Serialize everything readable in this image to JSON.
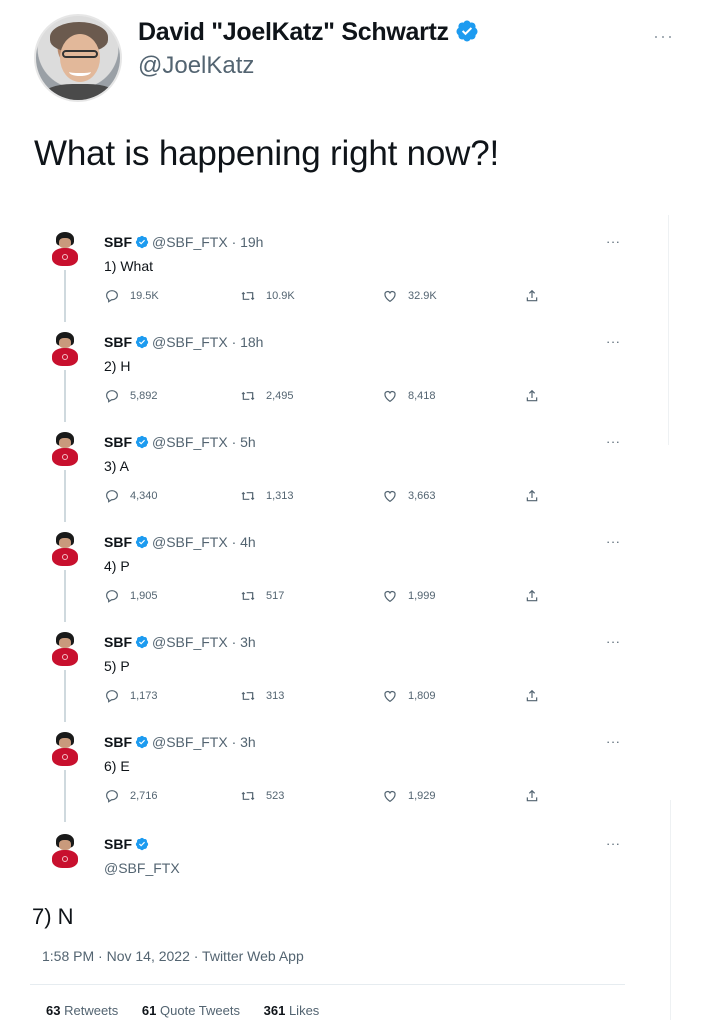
{
  "outer_tweet": {
    "author_name": "David \"JoelKatz\" Schwartz",
    "author_handle": "@JoelKatz",
    "text": "What is happening right now?!",
    "more_label": "···"
  },
  "thread": [
    {
      "name": "SBF",
      "handle": "@SBF_FTX",
      "time": "· 19h",
      "text": "1) What",
      "replies": "19.5K",
      "retweets": "10.9K",
      "likes": "32.9K"
    },
    {
      "name": "SBF",
      "handle": "@SBF_FTX",
      "time": "· 18h",
      "text": "2) H",
      "replies": "5,892",
      "retweets": "2,495",
      "likes": "8,418"
    },
    {
      "name": "SBF",
      "handle": "@SBF_FTX",
      "time": "· 5h",
      "text": "3) A",
      "replies": "4,340",
      "retweets": "1,313",
      "likes": "3,663"
    },
    {
      "name": "SBF",
      "handle": "@SBF_FTX",
      "time": "· 4h",
      "text": "4) P",
      "replies": "1,905",
      "retweets": "517",
      "likes": "1,999"
    },
    {
      "name": "SBF",
      "handle": "@SBF_FTX",
      "time": "· 3h",
      "text": "5) P",
      "replies": "1,173",
      "retweets": "313",
      "likes": "1,809"
    },
    {
      "name": "SBF",
      "handle": "@SBF_FTX",
      "time": "· 3h",
      "text": "6) E",
      "replies": "2,716",
      "retweets": "523",
      "likes": "1,929"
    }
  ],
  "last_tweet": {
    "name": "SBF",
    "handle": "@SBF_FTX",
    "text": "7) N",
    "meta": "1:58 PM · Nov 14, 2022 · Twitter Web App",
    "stats": {
      "retweets_count": "63",
      "retweets_label": "Retweets",
      "quotes_count": "61",
      "quotes_label": "Quote Tweets",
      "likes_count": "361",
      "likes_label": "Likes"
    }
  },
  "more_label": "···",
  "colors": {
    "verified": "#1d9bf0",
    "text_secondary": "#536471",
    "avatar_shirt": "#c8102e"
  },
  "icons": {
    "reply": "reply-icon",
    "retweet": "retweet-icon",
    "like": "heart-icon",
    "share": "share-icon",
    "verified": "verified-badge-icon"
  }
}
